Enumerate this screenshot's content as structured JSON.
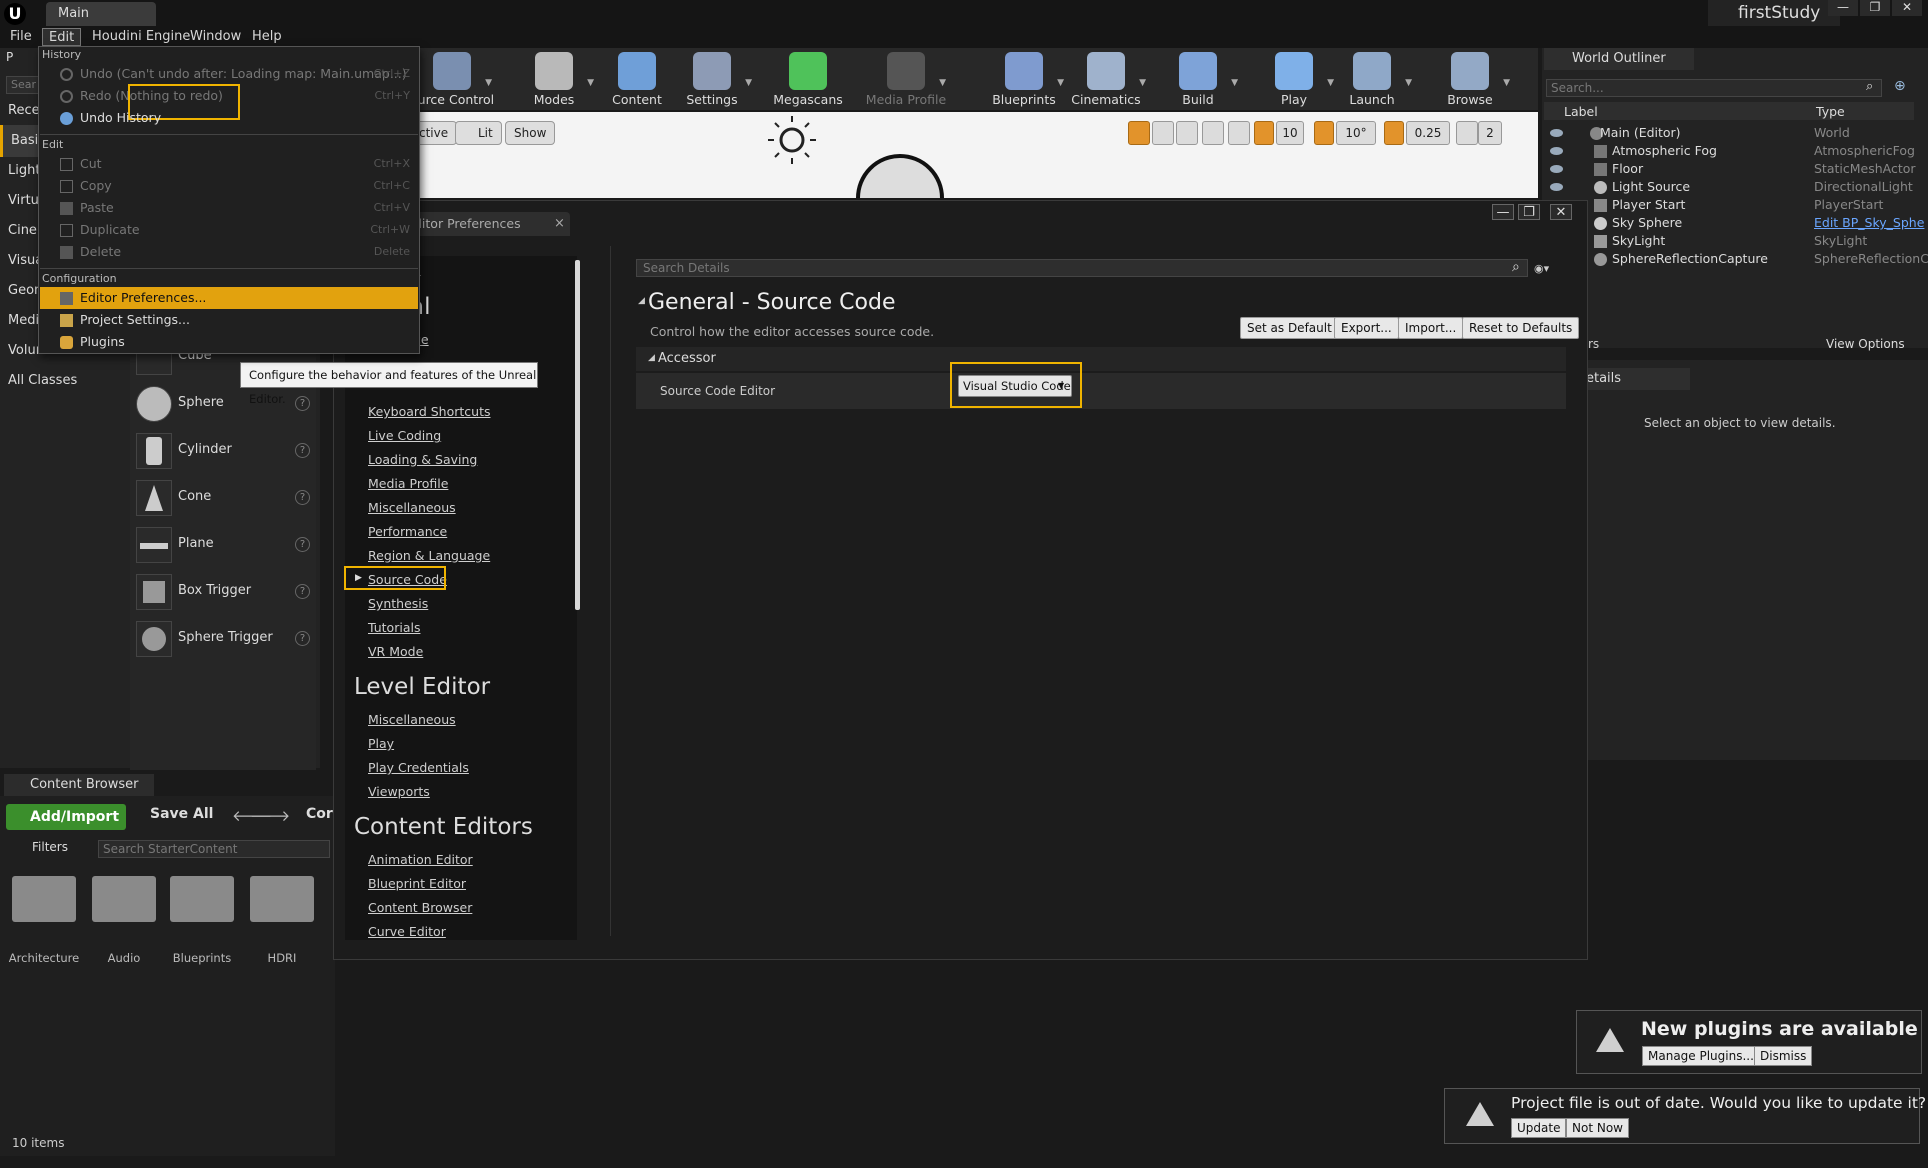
{
  "window": {
    "tab": "Main",
    "project": "firstStudy",
    "controls": [
      "—",
      "❐",
      "✕"
    ]
  },
  "menubar": [
    "File",
    "Edit",
    "Houdini Engine",
    "Window",
    "Help"
  ],
  "edit_menu": {
    "sections": {
      "history": "History",
      "edit": "Edit",
      "configuration": "Configuration"
    },
    "history_items": [
      {
        "label": "Undo (Can't undo after: Loading map: Main.umap...)",
        "shortcut": "Ctrl+Z"
      },
      {
        "label": "Redo (Nothing to redo)",
        "shortcut": "Ctrl+Y"
      },
      {
        "label": "Undo History",
        "shortcut": ""
      }
    ],
    "edit_items": [
      {
        "label": "Cut",
        "shortcut": "Ctrl+X"
      },
      {
        "label": "Copy",
        "shortcut": "Ctrl+C"
      },
      {
        "label": "Paste",
        "shortcut": "Ctrl+V"
      },
      {
        "label": "Duplicate",
        "shortcut": "Ctrl+W"
      },
      {
        "label": "Delete",
        "shortcut": "Delete"
      }
    ],
    "config_items": [
      {
        "label": "Editor Preferences..."
      },
      {
        "label": "Project Settings..."
      },
      {
        "label": "Plugins"
      }
    ]
  },
  "tooltip": "Configure the behavior and features of the Unreal Editor.",
  "toolbar": {
    "items": [
      {
        "label": "ource Control",
        "color": "#7a8fb0"
      },
      {
        "label": "Modes",
        "color": "#b9b9b9"
      },
      {
        "label": "Content",
        "color": "#6f9fd8"
      },
      {
        "label": "Settings",
        "color": "#8d9bb5"
      },
      {
        "label": "Megascans",
        "color": "#4fc25a"
      },
      {
        "label": "Media Profile",
        "color": "#555555"
      },
      {
        "label": "Blueprints",
        "color": "#7f9bcf"
      },
      {
        "label": "Cinematics",
        "color": "#9fb2cc"
      },
      {
        "label": "Build",
        "color": "#7ea3d8"
      },
      {
        "label": "Play",
        "color": "#7fb0e8"
      },
      {
        "label": "Launch",
        "color": "#8fa8c8"
      },
      {
        "label": "Browse",
        "color": "#93a9c6"
      }
    ]
  },
  "viewport": {
    "buttons": [
      "ctive",
      "Lit",
      "Show"
    ],
    "snaps": [
      "10",
      "10°",
      "0.25",
      "2"
    ]
  },
  "left_panel": {
    "search_stub": "Sear",
    "top_stub": "P",
    "categories": [
      "Recen",
      "Basic",
      "Light",
      "Virtu",
      "Cinem",
      "Visua",
      "Geom",
      "Media",
      "Volum",
      "All Classes"
    ],
    "items": [
      "Cube",
      "Sphere",
      "Cylinder",
      "Cone",
      "Plane",
      "Box Trigger",
      "Sphere Trigger"
    ],
    "help_glyph": "?"
  },
  "content_browser": {
    "tab": "Content Browser",
    "add_import": "Add/Import",
    "save_all": "Save All",
    "path_stub": "Cor",
    "filters": "Filters",
    "search_placeholder": "Search StarterContent",
    "folders": [
      "Architecture",
      "Audio",
      "Blueprints",
      "HDRI"
    ],
    "item_count": "10 items"
  },
  "preferences": {
    "tab": "ditor Preferences",
    "nav_top_stub": "s",
    "general_stub": "al",
    "appearance_stub": "ce",
    "general_links": [
      "Keyboard Shortcuts",
      "Live Coding",
      "Loading & Saving",
      "Media Profile",
      "Miscellaneous",
      "Performance",
      "Region & Language",
      "Source Code",
      "Synthesis",
      "Tutorials",
      "VR Mode"
    ],
    "level_editor": "Level Editor",
    "level_links": [
      "Miscellaneous",
      "Play",
      "Play Credentials",
      "Viewports"
    ],
    "content_editors": "Content Editors",
    "content_links": [
      "Animation Editor",
      "Blueprint Editor",
      "Content Browser",
      "Curve Editor"
    ],
    "search_placeholder": "Search Details",
    "title": "General - Source Code",
    "description": "Control how the editor accesses source code.",
    "buttons": [
      "Set as Default",
      "Export...",
      "Import...",
      "Reset to Defaults"
    ],
    "section": "Accessor",
    "row_label": "Source Code Editor",
    "row_value": "Visual Studio Code"
  },
  "outliner": {
    "tab": "World Outliner",
    "search_placeholder": "Search...",
    "col_label": "Label",
    "col_type": "Type",
    "rows": [
      {
        "label": "Main (Editor)",
        "type": "World"
      },
      {
        "label": "Atmospheric Fog",
        "type": "AtmosphericFog"
      },
      {
        "label": "Floor",
        "type": "StaticMeshActor"
      },
      {
        "label": "Light Source",
        "type": "DirectionalLight"
      },
      {
        "label": "Player Start",
        "type": "PlayerStart"
      },
      {
        "label": "Sky Sphere",
        "type": "Edit BP_Sky_Sphe"
      },
      {
        "label": "SkyLight",
        "type": "SkyLight"
      },
      {
        "label": "SphereReflectionCapture",
        "type": "SphereReflectionC"
      }
    ],
    "actors_stub": "rs",
    "view_options": "View Options"
  },
  "details": {
    "tab": "etails",
    "empty": "Select an object to view details."
  },
  "notifications": {
    "plugins_title": "New plugins are available",
    "manage": "Manage Plugins...",
    "dismiss": "Dismiss",
    "outdated": "Project file is out of date. Would you like to update it?",
    "update": "Update",
    "not_now": "Not Now",
    "view_options_stub": "View Options"
  },
  "colors": {
    "accent": "#e2a20e",
    "highlight_box": "#f0b400",
    "add_import": "#3b8f2c"
  }
}
